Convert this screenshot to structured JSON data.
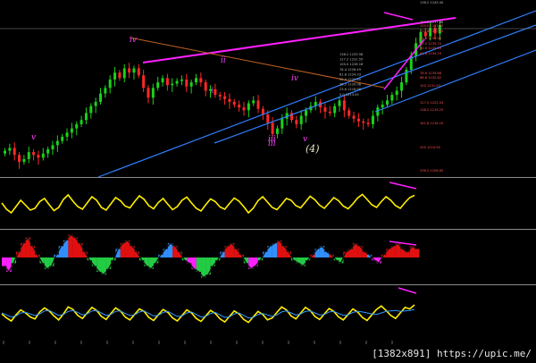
{
  "colors": {
    "background": "#000000",
    "bull": "#19d219",
    "bear": "#ff2828",
    "trendline": "#2f7fff",
    "wave_label": "#ff40ff",
    "oscillator": "#ffee00",
    "oscillator_signal": "#3399ff",
    "hist_pos": "#e01010",
    "hist_neg": "#22cc44",
    "hist_blue": "#2f8fff",
    "hist_pink": "#ff20ff",
    "level_text": "#ff5050",
    "level_text_upper": "#bbbbbb"
  },
  "watermark": "[1382x891] https://upic.me/",
  "chart_data": [
    {
      "type": "candlestick",
      "panel": "price",
      "grid": false,
      "ohlc_close_path": [
        1187,
        1189,
        1184,
        1179,
        1181,
        1186,
        1184,
        1182,
        1185,
        1188,
        1191,
        1194,
        1197,
        1200,
        1203,
        1206,
        1209,
        1214,
        1219,
        1222,
        1228,
        1232,
        1238,
        1243,
        1239,
        1246,
        1243,
        1246,
        1241,
        1232,
        1225,
        1232,
        1236,
        1239,
        1234,
        1235,
        1237,
        1238,
        1233,
        1236,
        1239,
        1236,
        1230,
        1231,
        1227,
        1226,
        1224,
        1222,
        1220,
        1218,
        1216,
        1221,
        1223,
        1217,
        1213,
        1207,
        1199,
        1203,
        1210,
        1214,
        1209,
        1206,
        1212,
        1216,
        1219,
        1222,
        1218,
        1215,
        1214,
        1219,
        1223,
        1216,
        1212,
        1210,
        1208,
        1207,
        1206,
        1212,
        1218,
        1220,
        1223,
        1227,
        1230,
        1236,
        1245,
        1255,
        1264,
        1272,
        1269,
        1275,
        1271,
        1277
      ],
      "wave_labels": [
        "iv",
        "v",
        "ii",
        "i",
        "iii",
        "iv",
        "v",
        "(4)",
        "iii"
      ],
      "level_labels": [
        "138.2 1243.40",
        "123.6 1237.38",
        "100.0 1237.80",
        "112.8 1237.85",
        "61.8 1236.96",
        "38.2 1235.70",
        "50.0 1235.16",
        "61.8 1234.29",
        "78.6 1233.68",
        "88.6 1232.62",
        "100 1231.93",
        "127.2 1222.04",
        "138.2 1219.25",
        "161.8 1216.10",
        "200 1210.90",
        "236.2 1206.85",
        "138.2 1233.58",
        "127.2 1231.55",
        "100.0 1228.18",
        "76.4 1226.49",
        "61.8 1224.33",
        "50.0 1222.60",
        "38.2 1220.98",
        "23.6 1218.98",
        "0.0 1213.05"
      ]
    },
    {
      "type": "line",
      "panel": "oscillator-1",
      "grid": false,
      "series": [
        {
          "values": [
            52,
            38,
            30,
            44,
            58,
            47,
            36,
            40,
            55,
            62,
            48,
            35,
            42,
            60,
            70,
            56,
            44,
            38,
            52,
            66,
            58,
            42,
            36,
            50,
            64,
            57,
            45,
            41,
            55,
            68,
            60,
            46,
            39,
            53,
            62,
            49,
            37,
            44,
            58,
            65,
            52,
            40,
            34,
            48,
            61,
            55,
            43,
            38,
            51,
            63,
            56,
            44,
            30,
            40,
            57,
            66,
            54,
            42,
            37,
            49,
            62,
            58,
            46,
            41,
            54,
            67,
            59,
            47,
            40,
            52,
            64,
            57,
            45,
            39,
            50,
            63,
            71,
            60,
            48,
            42,
            55,
            66,
            58,
            46,
            40,
            53,
            64,
            69
          ]
        }
      ]
    },
    {
      "type": "bar",
      "panel": "histogram-2",
      "grid": false,
      "series": [
        {
          "values": [
            -3,
            -5,
            -2,
            2,
            5,
            7,
            4,
            1,
            -2,
            -4,
            -3,
            1,
            4,
            6,
            8,
            7,
            5,
            2,
            -1,
            -3,
            -5,
            -6,
            -4,
            -1,
            3,
            5,
            6,
            4,
            2,
            -1,
            -3,
            -4,
            -2,
            1,
            3,
            5,
            4,
            2,
            -1,
            -2,
            -4,
            -5,
            -7,
            -6,
            -3,
            -1,
            2,
            4,
            5,
            3,
            1,
            -2,
            -4,
            -3,
            -1,
            2,
            4,
            5,
            6,
            4,
            2,
            -1,
            -2,
            -3,
            -1,
            1,
            3,
            4,
            2,
            1,
            -1,
            -2,
            2,
            3,
            5,
            4,
            2,
            1,
            -1,
            -2,
            1,
            3,
            4,
            5,
            3,
            2,
            4,
            3
          ]
        }
      ]
    },
    {
      "type": "line",
      "panel": "oscillator-3",
      "grid": false,
      "series": [
        {
          "values": [
            48,
            40,
            34,
            46,
            56,
            50,
            42,
            38,
            52,
            60,
            54,
            44,
            36,
            48,
            62,
            57,
            45,
            39,
            50,
            61,
            55,
            43,
            37,
            49,
            60,
            54,
            42,
            36,
            47,
            58,
            53,
            41,
            35,
            46,
            57,
            51,
            40,
            34,
            45,
            56,
            50,
            39,
            33,
            44,
            55,
            49,
            38,
            32,
            43,
            54,
            48,
            37,
            31,
            42,
            53,
            47,
            36,
            40,
            51,
            62,
            56,
            44,
            38,
            50,
            61,
            55,
            43,
            37,
            48,
            59,
            53,
            42,
            36,
            47,
            58,
            52,
            41,
            35,
            46,
            57,
            64,
            55,
            45,
            39,
            50,
            61,
            58,
            66
          ]
        },
        {
          "values": [
            50,
            46,
            42,
            44,
            50,
            51,
            48,
            45,
            48,
            54,
            55,
            50,
            45,
            47,
            53,
            55,
            51,
            46,
            48,
            54,
            55,
            50,
            45,
            47,
            53,
            54,
            49,
            45,
            46,
            52,
            54,
            49,
            44,
            45,
            51,
            53,
            48,
            43,
            44,
            50,
            52,
            47,
            42,
            43,
            49,
            51,
            46,
            41,
            42,
            48,
            50,
            45,
            40,
            41,
            47,
            49,
            46,
            43,
            46,
            52,
            54,
            50,
            46,
            48,
            53,
            54,
            50,
            46,
            47,
            52,
            53,
            49,
            45,
            46,
            51,
            53,
            52,
            50,
            48,
            47,
            50,
            53,
            54,
            55,
            53,
            54,
            55,
            57
          ]
        }
      ]
    }
  ]
}
